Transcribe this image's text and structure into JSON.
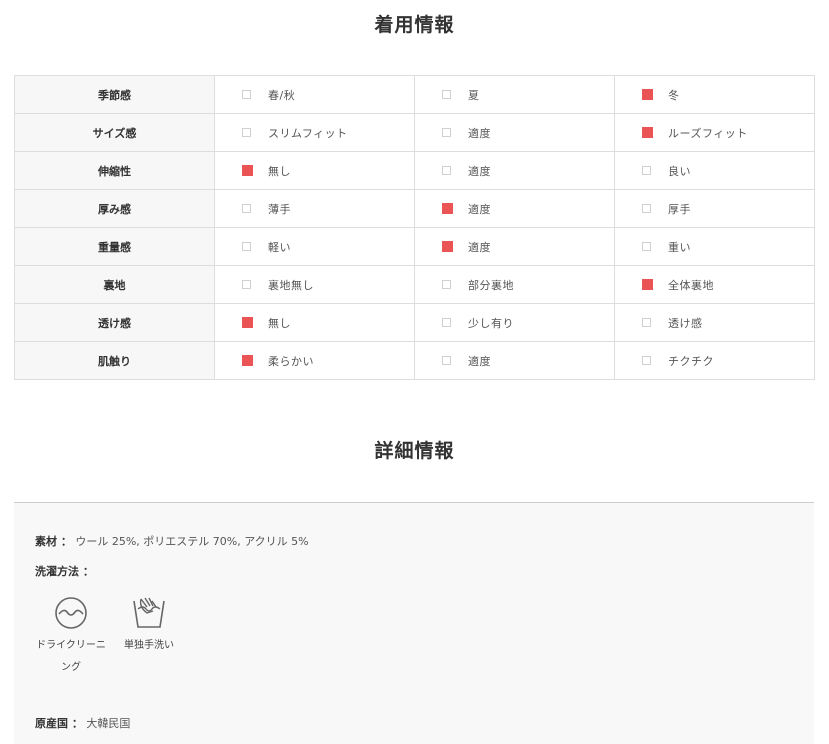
{
  "wear_info": {
    "title": "着用情報",
    "rows": [
      {
        "label": "季節感",
        "options": [
          {
            "text": "春/秋",
            "checked": false
          },
          {
            "text": "夏",
            "checked": false
          },
          {
            "text": "冬",
            "checked": true
          }
        ]
      },
      {
        "label": "サイズ感",
        "options": [
          {
            "text": "スリムフィット",
            "checked": false
          },
          {
            "text": "適度",
            "checked": false
          },
          {
            "text": "ルーズフィット",
            "checked": true
          }
        ]
      },
      {
        "label": "伸縮性",
        "options": [
          {
            "text": "無し",
            "checked": true
          },
          {
            "text": "適度",
            "checked": false
          },
          {
            "text": "良い",
            "checked": false
          }
        ]
      },
      {
        "label": "厚み感",
        "options": [
          {
            "text": "薄手",
            "checked": false
          },
          {
            "text": "適度",
            "checked": true
          },
          {
            "text": "厚手",
            "checked": false
          }
        ]
      },
      {
        "label": "重量感",
        "options": [
          {
            "text": "軽い",
            "checked": false
          },
          {
            "text": "適度",
            "checked": true
          },
          {
            "text": "重い",
            "checked": false
          }
        ]
      },
      {
        "label": "裏地",
        "options": [
          {
            "text": "裏地無し",
            "checked": false
          },
          {
            "text": "部分裏地",
            "checked": false
          },
          {
            "text": "全体裏地",
            "checked": true
          }
        ]
      },
      {
        "label": "透け感",
        "options": [
          {
            "text": "無し",
            "checked": true
          },
          {
            "text": "少し有り",
            "checked": false
          },
          {
            "text": "透け感",
            "checked": false
          }
        ]
      },
      {
        "label": "肌触り",
        "options": [
          {
            "text": "柔らかい",
            "checked": true
          },
          {
            "text": "適度",
            "checked": false
          },
          {
            "text": "チクチク",
            "checked": false
          }
        ]
      }
    ]
  },
  "detail_info": {
    "title": "詳細情報",
    "material_label": "素材 ：",
    "material_value": "ウール 25%, ポリエステル 70%, アクリル 5%",
    "washing_label": "洗濯方法 ：",
    "washing_methods": [
      {
        "icon": "dry-clean-icon",
        "label_line1": "ドライクリーニ",
        "label_line2": "ング"
      },
      {
        "icon": "hand-wash-icon",
        "label_line1": "単独手洗い",
        "label_line2": ""
      }
    ],
    "origin_label": "原産国 ：",
    "origin_value": "大韓民国"
  },
  "colors": {
    "checked": "#ea5454",
    "unchecked_border": "#d0d0d0",
    "label_bg": "#f7f7f7",
    "detail_bg": "#f8f8f8"
  }
}
